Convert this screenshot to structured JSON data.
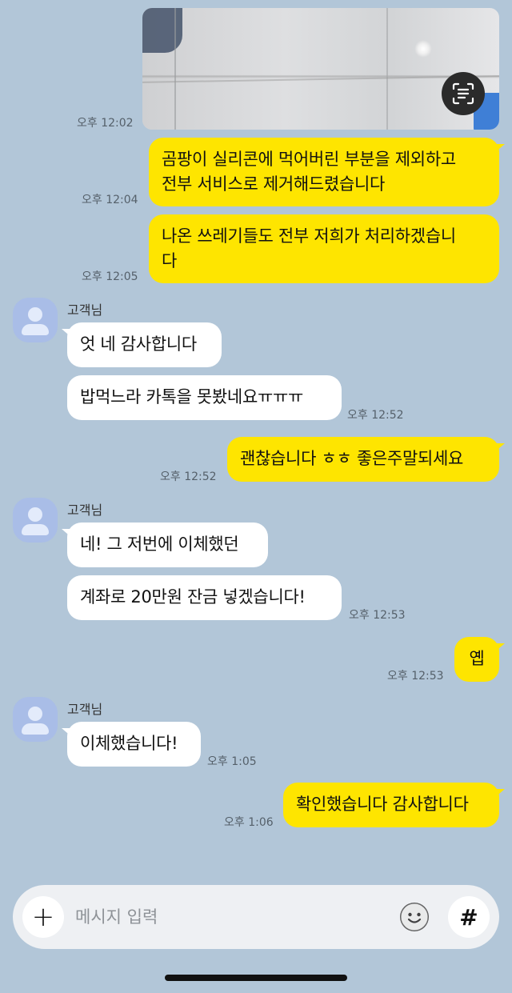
{
  "messages": [
    {
      "time": "오후 12:02"
    },
    {
      "text": "곰팡이 실리콘에 먹어버린 부분을 제외하고 전부 서비스로 제거해드렸습니다",
      "line1": "곰팡이 실리콘에 먹어버린 부분을 제외하고",
      "line2": "전부 서비스로 제거해드렸습니다",
      "time": "오후 12:04"
    },
    {
      "line1": "나온 쓰레기들도 전부 저희가 처리하겠습니",
      "line2": "다",
      "time": "오후 12:05"
    },
    {
      "sender": "고객님",
      "text": "엇 네 감사합니다"
    },
    {
      "text": "밥먹느라 카톡을 못봤네요ㅠㅠㅠ",
      "time": "오후 12:52"
    },
    {
      "text": "괜찮습니다 ㅎㅎ 좋은주말되세요",
      "time": "오후 12:52"
    },
    {
      "sender": "고객님",
      "text": "네! 그 저번에 이체했던"
    },
    {
      "text": "계좌로 20만원 잔금 넣겠습니다!",
      "time": "오후 12:53"
    },
    {
      "text": "옙",
      "time": "오후 12:53"
    },
    {
      "sender": "고객님",
      "text": "이체했습니다!",
      "time": "오후 1:05"
    },
    {
      "text": "확인했습니다 감사합니다",
      "time": "오후 1:06"
    }
  ],
  "input": {
    "placeholder": "메시지 입력",
    "plus": "+",
    "hash": "#"
  },
  "icons": {
    "scan": "text-scan-icon",
    "emoji": "emoji-icon",
    "avatar": "person-icon"
  },
  "colors": {
    "background": "#b2c6d8",
    "my_bubble": "#fee500",
    "their_bubble": "#ffffff"
  }
}
